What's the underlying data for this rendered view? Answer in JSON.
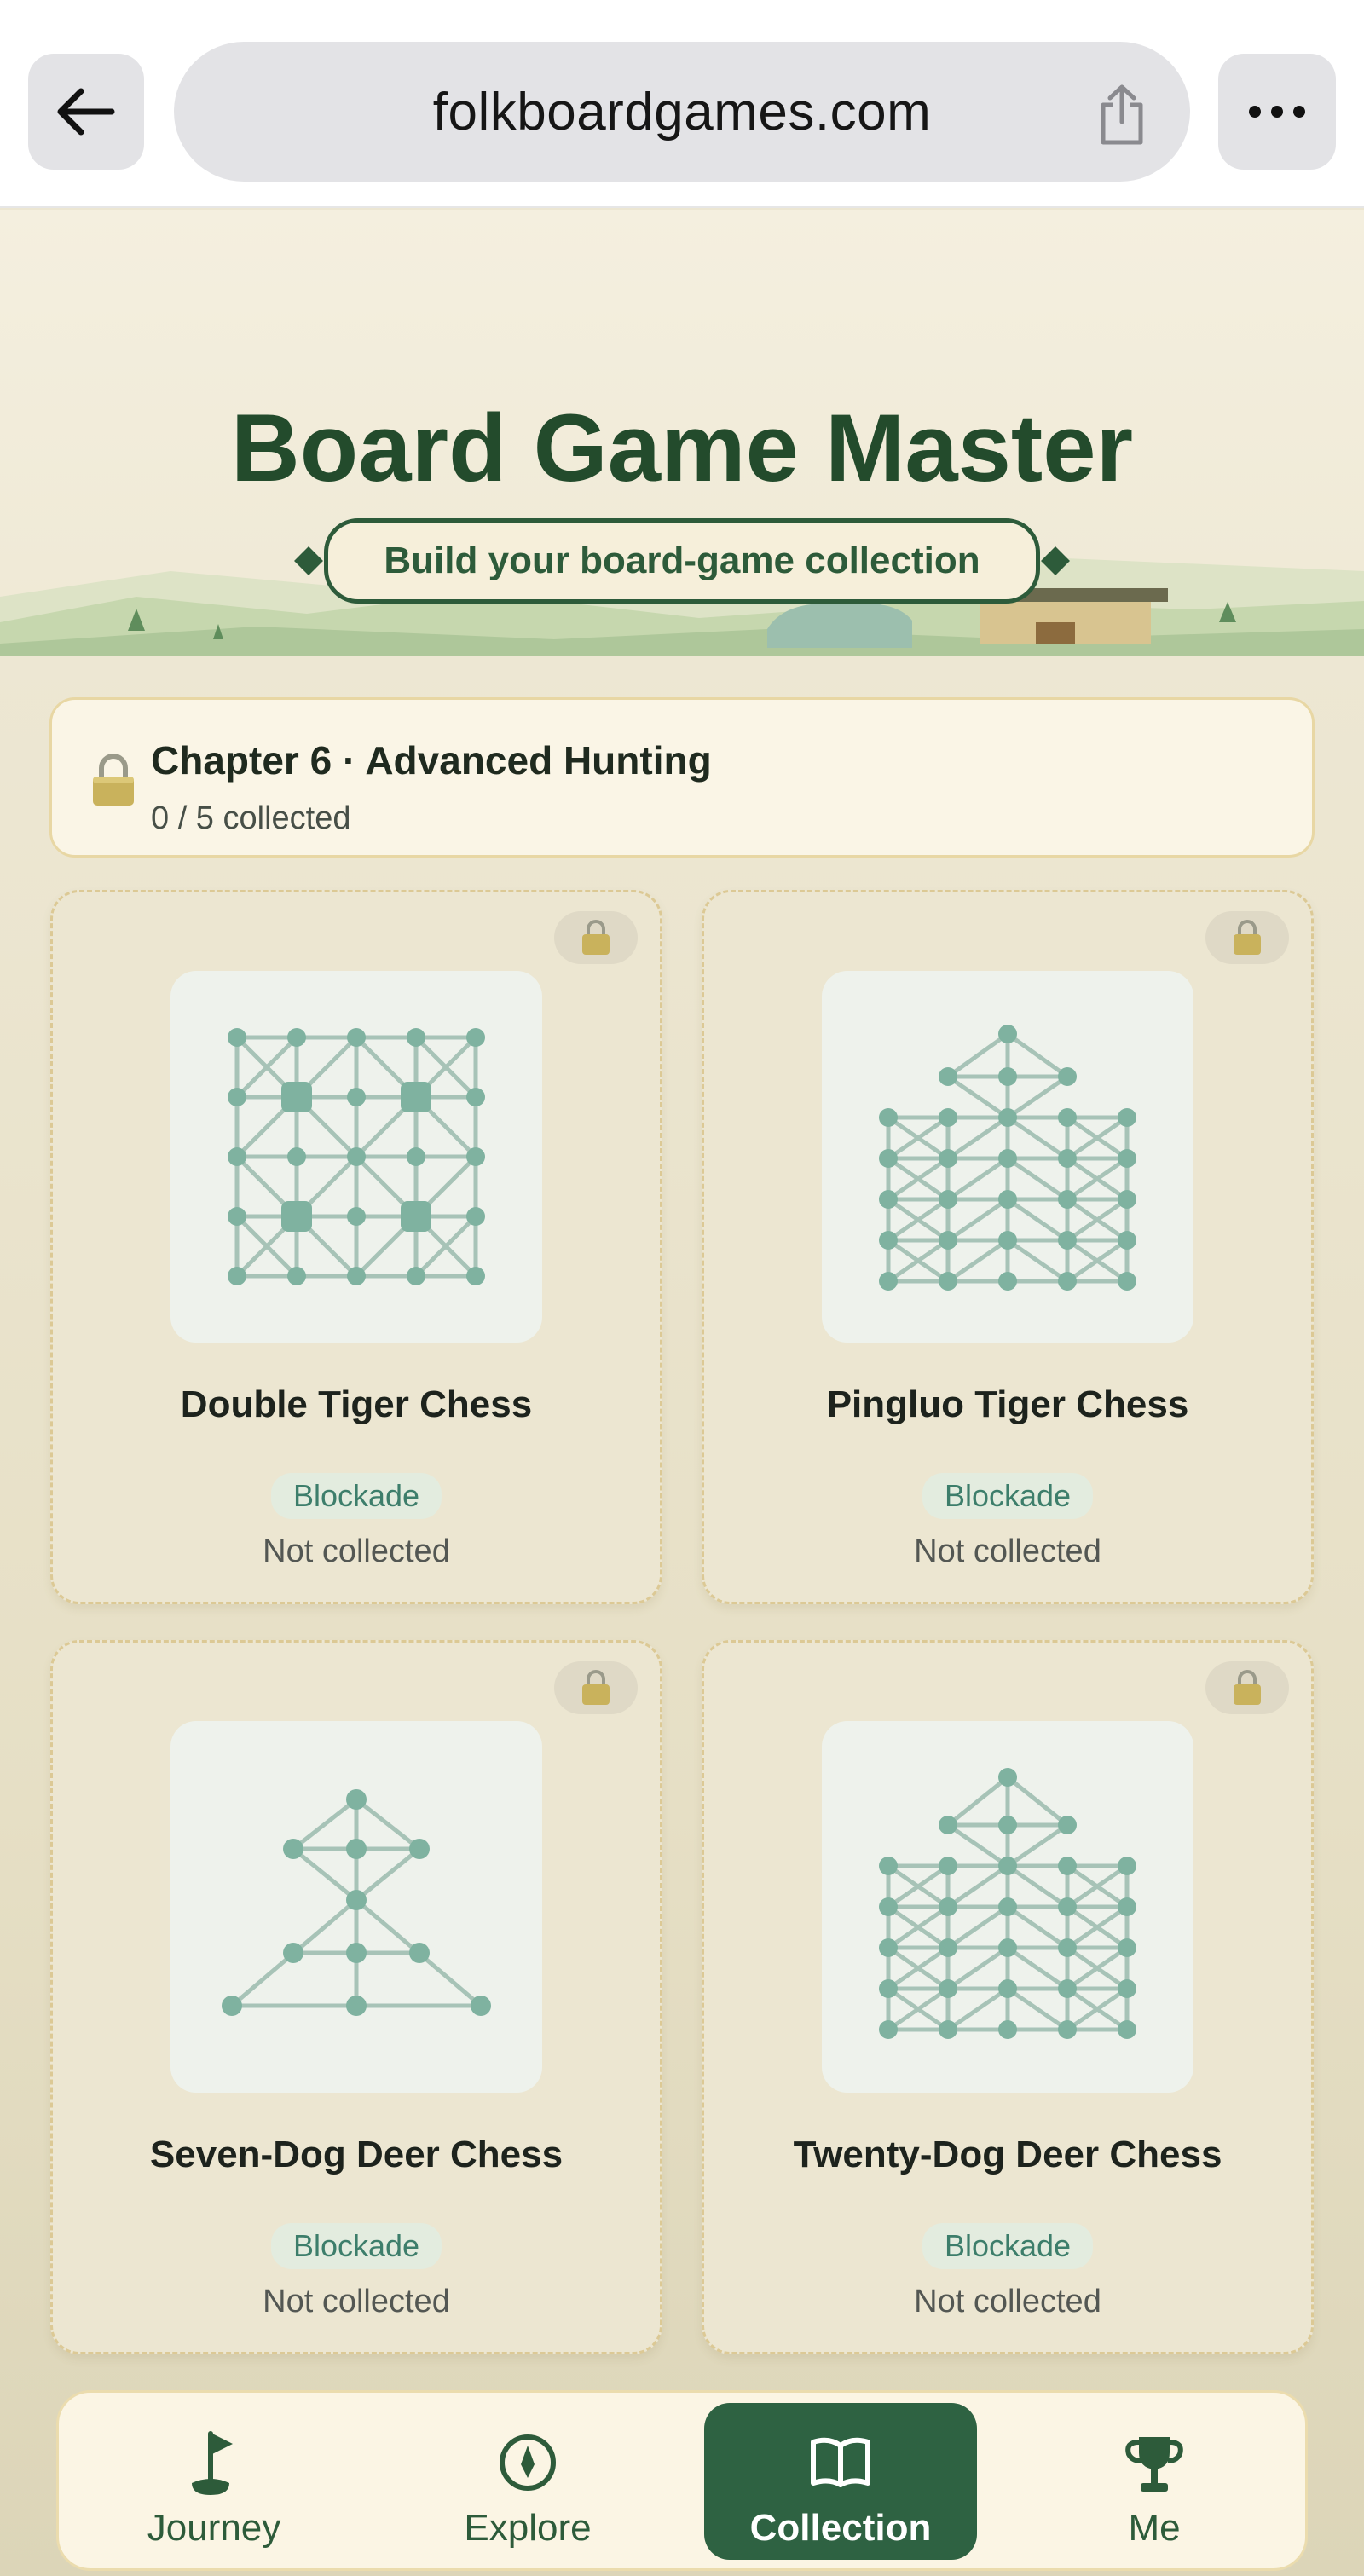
{
  "browser": {
    "url": "folkboardgames.com",
    "icons": {
      "back": "arrow-left-icon",
      "share": "share-icon",
      "more": "more-dots-icon"
    }
  },
  "hero": {
    "title": "Board Game Master",
    "subtitle": "Build your board-game collection"
  },
  "chapter": {
    "title": "Chapter 6 · Advanced Hunting",
    "progress": "0 / 5 collected",
    "icon": "lock-icon"
  },
  "games": [
    {
      "name": "Double Tiger Chess",
      "tag": "Blockade",
      "status": "Not collected",
      "board": "grid-5x5-double"
    },
    {
      "name": "Pingluo Tiger Chess",
      "tag": "Blockade",
      "status": "Not collected",
      "board": "grid-with-mountain"
    },
    {
      "name": "Seven-Dog Deer Chess",
      "tag": "Blockade",
      "status": "Not collected",
      "board": "triangle-with-mountain"
    },
    {
      "name": "Twenty-Dog Deer Chess",
      "tag": "Blockade",
      "status": "Not collected",
      "board": "grid-with-mountain"
    }
  ],
  "nav": {
    "items": [
      {
        "label": "Journey",
        "icon": "flag-icon"
      },
      {
        "label": "Explore",
        "icon": "compass-icon"
      },
      {
        "label": "Collection",
        "icon": "book-icon",
        "active": true
      },
      {
        "label": "Me",
        "icon": "trophy-icon"
      }
    ]
  },
  "colors": {
    "primary_green": "#2e6242",
    "title_green": "#234b2c",
    "board_teal": "#7fb2a0",
    "tag_text": "#3d7e6b",
    "background": "#ece6d2"
  }
}
